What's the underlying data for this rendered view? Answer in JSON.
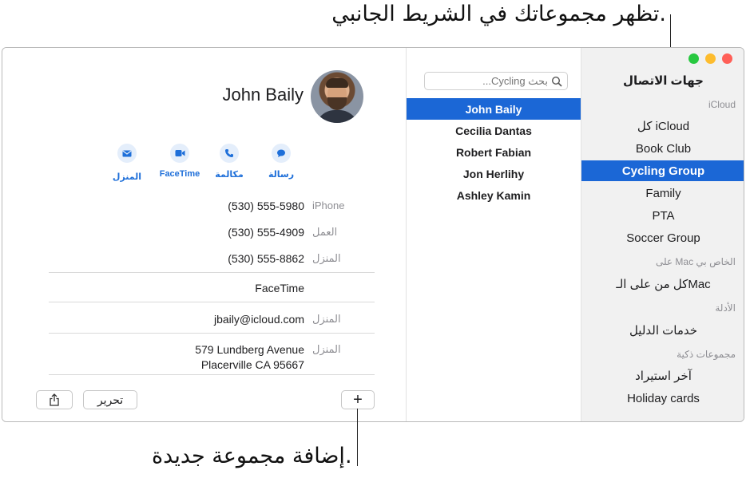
{
  "callouts": {
    "top": "تظهر مجموعاتك في الشريط الجانبي.",
    "bottom": "إضافة مجموعة جديدة."
  },
  "sidebar": {
    "title": "جهات الاتصال",
    "sections": [
      {
        "header": "iCloud",
        "items": [
          "كل iCloud",
          "Book Club",
          "Cycling Group",
          "Family",
          "PTA",
          "Soccer Group"
        ]
      },
      {
        "header": "على Mac الخاص بي",
        "items": [
          "كل من على الـMac"
        ]
      },
      {
        "header": "الأدلة",
        "items": [
          "خدمات الدليل"
        ]
      },
      {
        "header": "مجموعات ذكية",
        "items": [
          "آخر استيراد",
          "Holiday cards"
        ]
      }
    ],
    "selected": "Cycling Group"
  },
  "list": {
    "search_placeholder": "بحث Cycling...",
    "contacts": [
      "John Baily",
      "Cecilia Dantas",
      "Robert Fabian",
      "Jon Herlihy",
      "Ashley Kamin"
    ],
    "selected": "John Baily"
  },
  "detail": {
    "name": "John Baily",
    "actions": {
      "message": "رسالة",
      "call": "مكالمة",
      "facetime": "FaceTime",
      "home": "المنزل"
    },
    "phones": [
      {
        "label": "iPhone",
        "value": "(530) 555-5980"
      },
      {
        "label": "العمل",
        "value": "(530) 555-4909"
      },
      {
        "label": "المنزل",
        "value": "(530) 555-8862"
      }
    ],
    "facetime_value": "FaceTime",
    "email": {
      "label": "المنزل",
      "value": "jbaily@icloud.com"
    },
    "address": {
      "label": "المنزل",
      "line1": "579 Lundberg Avenue",
      "line2": "Placerville CA 95667"
    }
  },
  "toolbar": {
    "edit_label": "تحرير",
    "add_label": "+"
  },
  "colors": {
    "accent": "#1b67d6",
    "action_blue": "#1e6fd9",
    "sidebar_bg": "#f1f1f1"
  }
}
